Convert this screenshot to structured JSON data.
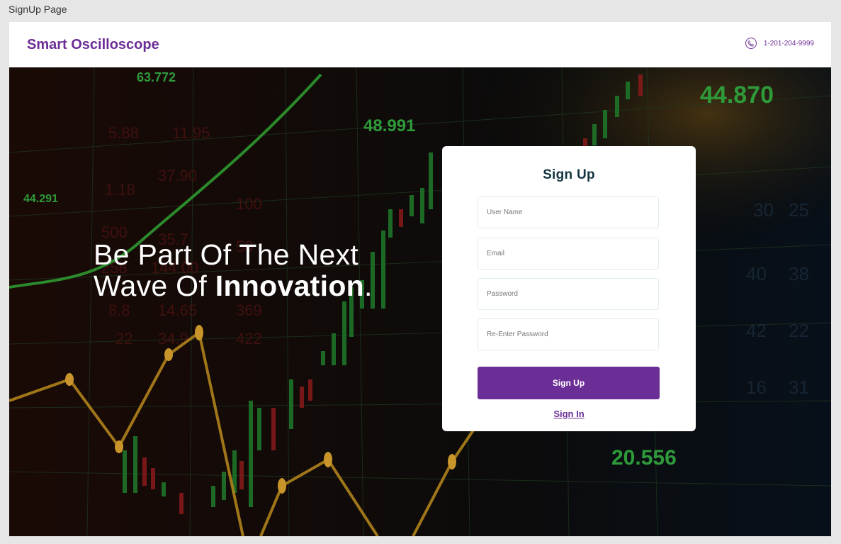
{
  "frame_label": "SignUp Page",
  "header": {
    "brand": "Smart Oscilloscope",
    "phone": "1-201-204-9999"
  },
  "hero": {
    "headline_line1": "Be Part Of The Next",
    "headline_line2_prefix": "Wave Of ",
    "headline_line2_bold": "Innovation",
    "headline_line2_suffix": ".",
    "background_numbers": [
      "63.772",
      "48.991",
      "44.870",
      "44.291",
      "20.556"
    ]
  },
  "form": {
    "title": "Sign Up",
    "username_placeholder": "User Name",
    "email_placeholder": "Email",
    "password_placeholder": "Password",
    "reenter_password_placeholder": "Re-Enter Password",
    "submit_label": "Sign Up",
    "signin_link": "Sign In"
  },
  "colors": {
    "brand": "#6b2d96",
    "title": "#12343f"
  }
}
